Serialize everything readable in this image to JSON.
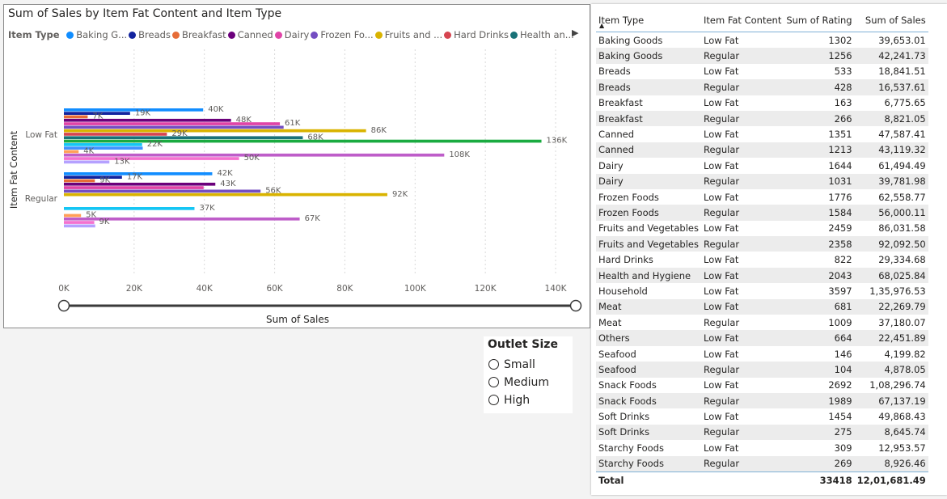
{
  "chart": {
    "title": "Sum of Sales by Item Fat Content and Item Type",
    "legend_title": "Item Type",
    "legend_items": [
      {
        "label": "Baking G...",
        "color": "#118DFF"
      },
      {
        "label": "Breads",
        "color": "#12239E"
      },
      {
        "label": "Breakfast",
        "color": "#E66C37"
      },
      {
        "label": "Canned",
        "color": "#6B007B"
      },
      {
        "label": "Dairy",
        "color": "#E044A7"
      },
      {
        "label": "Frozen Fo...",
        "color": "#744EC2"
      },
      {
        "label": "Fruits and ...",
        "color": "#D9B300"
      },
      {
        "label": "Hard Drinks",
        "color": "#D64550"
      },
      {
        "label": "Health an...",
        "color": "#197278"
      }
    ],
    "legend_next_icon": "chevron-right-icon",
    "y_axis_title": "Item Fat Content",
    "x_axis_title": "Sum of Sales",
    "chart_data": {
      "type": "bar",
      "orientation": "horizontal",
      "title": "Sum of Sales by Item Fat Content and Item Type",
      "xlabel": "Sum of Sales",
      "ylabel": "Item Fat Content",
      "categories": [
        "Low Fat",
        "Regular"
      ],
      "xlim": [
        0,
        140000
      ],
      "x_ticks": [
        "0K",
        "20K",
        "40K",
        "60K",
        "80K",
        "100K",
        "120K",
        "140K"
      ],
      "x_tick_values": [
        0,
        20000,
        40000,
        60000,
        80000,
        100000,
        120000,
        140000
      ],
      "gridlines": true,
      "series": [
        {
          "name": "Baking Goods",
          "color": "#118DFF",
          "values": [
            39653.01,
            42241.73
          ],
          "labels": [
            "40K",
            "42K"
          ]
        },
        {
          "name": "Breads",
          "color": "#12239E",
          "values": [
            18841.51,
            16537.61
          ],
          "labels": [
            "19K",
            "17K"
          ]
        },
        {
          "name": "Breakfast",
          "color": "#E66C37",
          "values": [
            6775.65,
            8821.05
          ],
          "labels": [
            "7K",
            "9K"
          ]
        },
        {
          "name": "Canned",
          "color": "#6B007B",
          "values": [
            47587.41,
            43119.32
          ],
          "labels": [
            "48K",
            "43K"
          ]
        },
        {
          "name": "Dairy",
          "color": "#E044A7",
          "values": [
            61494.49,
            39781.98
          ],
          "labels": [
            "61K",
            ""
          ]
        },
        {
          "name": "Frozen Foods",
          "color": "#744EC2",
          "values": [
            62558.77,
            56000.11
          ],
          "labels": [
            "",
            "56K"
          ]
        },
        {
          "name": "Fruits and Vegetables",
          "color": "#D9B300",
          "values": [
            86031.58,
            92092.5
          ],
          "labels": [
            "86K",
            "92K"
          ]
        },
        {
          "name": "Hard Drinks",
          "color": "#D64550",
          "values": [
            29334.68,
            0
          ],
          "labels": [
            "29K",
            ""
          ]
        },
        {
          "name": "Health and Hygiene",
          "color": "#197278",
          "values": [
            68025.84,
            0
          ],
          "labels": [
            "68K",
            ""
          ]
        },
        {
          "name": "Household",
          "color": "#1AAB40",
          "values": [
            135976.53,
            0
          ],
          "labels": [
            "136K",
            ""
          ]
        },
        {
          "name": "Meat",
          "color": "#15C6F4",
          "values": [
            22269.79,
            37180.07
          ],
          "labels": [
            "22K",
            "37K"
          ]
        },
        {
          "name": "Others",
          "color": "#4092FF",
          "values": [
            22451.89,
            0
          ],
          "labels": [
            "",
            ""
          ]
        },
        {
          "name": "Seafood",
          "color": "#FFA058",
          "values": [
            4199.82,
            4878.05
          ],
          "labels": [
            "4K",
            "5K"
          ]
        },
        {
          "name": "Snack Foods",
          "color": "#BE5DC9",
          "values": [
            108296.74,
            67137.19
          ],
          "labels": [
            "108K",
            "67K"
          ]
        },
        {
          "name": "Soft Drinks",
          "color": "#F472D0",
          "values": [
            49868.43,
            8645.74
          ],
          "labels": [
            "50K",
            "9K"
          ]
        },
        {
          "name": "Starchy Foods",
          "color": "#B5A1FF",
          "values": [
            12953.57,
            8926.46
          ],
          "labels": [
            "13K",
            ""
          ]
        }
      ]
    }
  },
  "slicer": {
    "title": "Outlet Size",
    "options": [
      "Small",
      "Medium",
      "High"
    ]
  },
  "table": {
    "headers": [
      "Item Type",
      "Item Fat Content",
      "Sum of Rating",
      "Sum of Sales"
    ],
    "rows": [
      [
        "Baking Goods",
        "Low Fat",
        "1302",
        "39,653.01"
      ],
      [
        "Baking Goods",
        "Regular",
        "1256",
        "42,241.73"
      ],
      [
        "Breads",
        "Low Fat",
        "533",
        "18,841.51"
      ],
      [
        "Breads",
        "Regular",
        "428",
        "16,537.61"
      ],
      [
        "Breakfast",
        "Low Fat",
        "163",
        "6,775.65"
      ],
      [
        "Breakfast",
        "Regular",
        "266",
        "8,821.05"
      ],
      [
        "Canned",
        "Low Fat",
        "1351",
        "47,587.41"
      ],
      [
        "Canned",
        "Regular",
        "1213",
        "43,119.32"
      ],
      [
        "Dairy",
        "Low Fat",
        "1644",
        "61,494.49"
      ],
      [
        "Dairy",
        "Regular",
        "1031",
        "39,781.98"
      ],
      [
        "Frozen Foods",
        "Low Fat",
        "1776",
        "62,558.77"
      ],
      [
        "Frozen Foods",
        "Regular",
        "1584",
        "56,000.11"
      ],
      [
        "Fruits and Vegetables",
        "Low Fat",
        "2459",
        "86,031.58"
      ],
      [
        "Fruits and Vegetables",
        "Regular",
        "2358",
        "92,092.50"
      ],
      [
        "Hard Drinks",
        "Low Fat",
        "822",
        "29,334.68"
      ],
      [
        "Health and Hygiene",
        "Low Fat",
        "2043",
        "68,025.84"
      ],
      [
        "Household",
        "Low Fat",
        "3597",
        "1,35,976.53"
      ],
      [
        "Meat",
        "Low Fat",
        "681",
        "22,269.79"
      ],
      [
        "Meat",
        "Regular",
        "1009",
        "37,180.07"
      ],
      [
        "Others",
        "Low Fat",
        "664",
        "22,451.89"
      ],
      [
        "Seafood",
        "Low Fat",
        "146",
        "4,199.82"
      ],
      [
        "Seafood",
        "Regular",
        "104",
        "4,878.05"
      ],
      [
        "Snack Foods",
        "Low Fat",
        "2692",
        "1,08,296.74"
      ],
      [
        "Snack Foods",
        "Regular",
        "1989",
        "67,137.19"
      ],
      [
        "Soft Drinks",
        "Low Fat",
        "1454",
        "49,868.43"
      ],
      [
        "Soft Drinks",
        "Regular",
        "275",
        "8,645.74"
      ],
      [
        "Starchy Foods",
        "Low Fat",
        "309",
        "12,953.57"
      ],
      [
        "Starchy Foods",
        "Regular",
        "269",
        "8,926.46"
      ]
    ],
    "total": [
      "Total",
      "",
      "33418",
      "12,01,681.49"
    ],
    "sort_icon": "sort-ascending-icon"
  }
}
